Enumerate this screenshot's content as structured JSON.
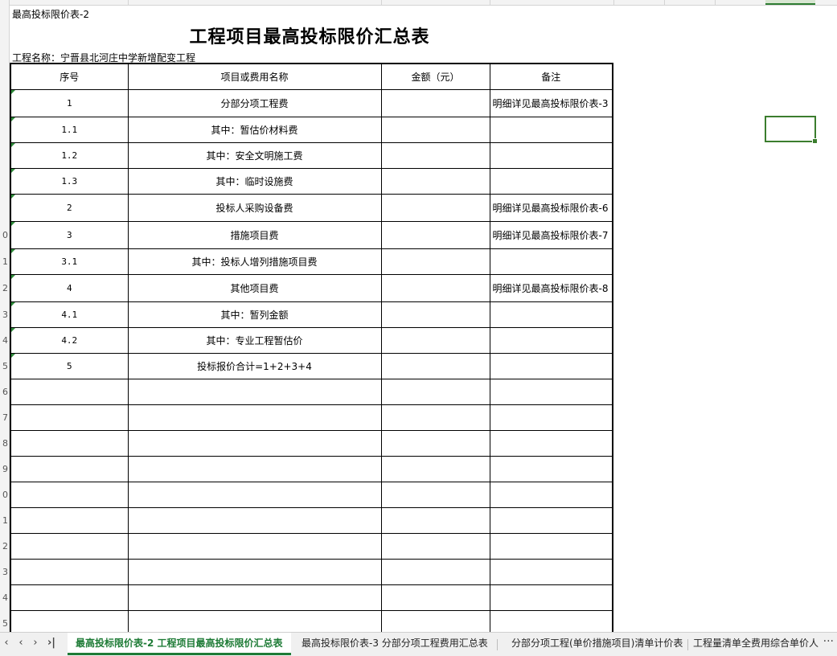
{
  "sheet": {
    "subtitle": "最高投标限价表-2",
    "title": "工程项目最高投标限价汇总表",
    "project_name": "工程名称：宁晋县北河庄中学新增配变工程"
  },
  "table": {
    "headers": [
      "序号",
      "项目或费用名称",
      "金额（元）",
      "备注"
    ],
    "rows": [
      {
        "no": "1",
        "name": "分部分项工程费",
        "amount": "",
        "remark": "明细详见最高投标限价表-3"
      },
      {
        "no": "1.1",
        "name": "其中：暂估价材料费",
        "amount": "",
        "remark": ""
      },
      {
        "no": "1.2",
        "name": "其中：安全文明施工费",
        "amount": "",
        "remark": ""
      },
      {
        "no": "1.3",
        "name": "其中：临时设施费",
        "amount": "",
        "remark": ""
      },
      {
        "no": "2",
        "name": "投标人采购设备费",
        "amount": "",
        "remark": "明细详见最高投标限价表-6"
      },
      {
        "no": "3",
        "name": "措施项目费",
        "amount": "",
        "remark": "明细详见最高投标限价表-7"
      },
      {
        "no": "3.1",
        "name": "其中：投标人增列措施项目费",
        "amount": "",
        "remark": ""
      },
      {
        "no": "4",
        "name": "其他项目费",
        "amount": "",
        "remark": "明细详见最高投标限价表-8"
      },
      {
        "no": "4.1",
        "name": "其中：暂列金额",
        "amount": "",
        "remark": ""
      },
      {
        "no": "4.2",
        "name": "其中：专业工程暂估价",
        "amount": "",
        "remark": ""
      },
      {
        "no": "5",
        "name": "投标报价合计=1+2+3+4",
        "amount": "",
        "remark": ""
      }
    ],
    "empty_rows": 10
  },
  "row_numbers": [
    "0",
    "1",
    "2",
    "3",
    "4",
    "5",
    "6",
    "7",
    "8",
    "9",
    "0",
    "1",
    "2",
    "3",
    "4",
    "5"
  ],
  "tabs": [
    {
      "label": "最高投标限价表-2 工程项目最高投标限价汇总表",
      "active": true
    },
    {
      "label": "最高投标限价表-3 分部分项工程费用汇总表",
      "active": false
    },
    {
      "label": "分部分项工程(单价措施项目)清单计价表",
      "active": false
    },
    {
      "label": "工程量清单全费用综合单价人",
      "active": false
    }
  ],
  "tab_nav": {
    "first": "|<",
    "prev": "<",
    "next": ">",
    "last": ">|",
    "more": "···"
  },
  "colors": {
    "accent": "#1e7b36",
    "selection": "#3b7d2e"
  }
}
